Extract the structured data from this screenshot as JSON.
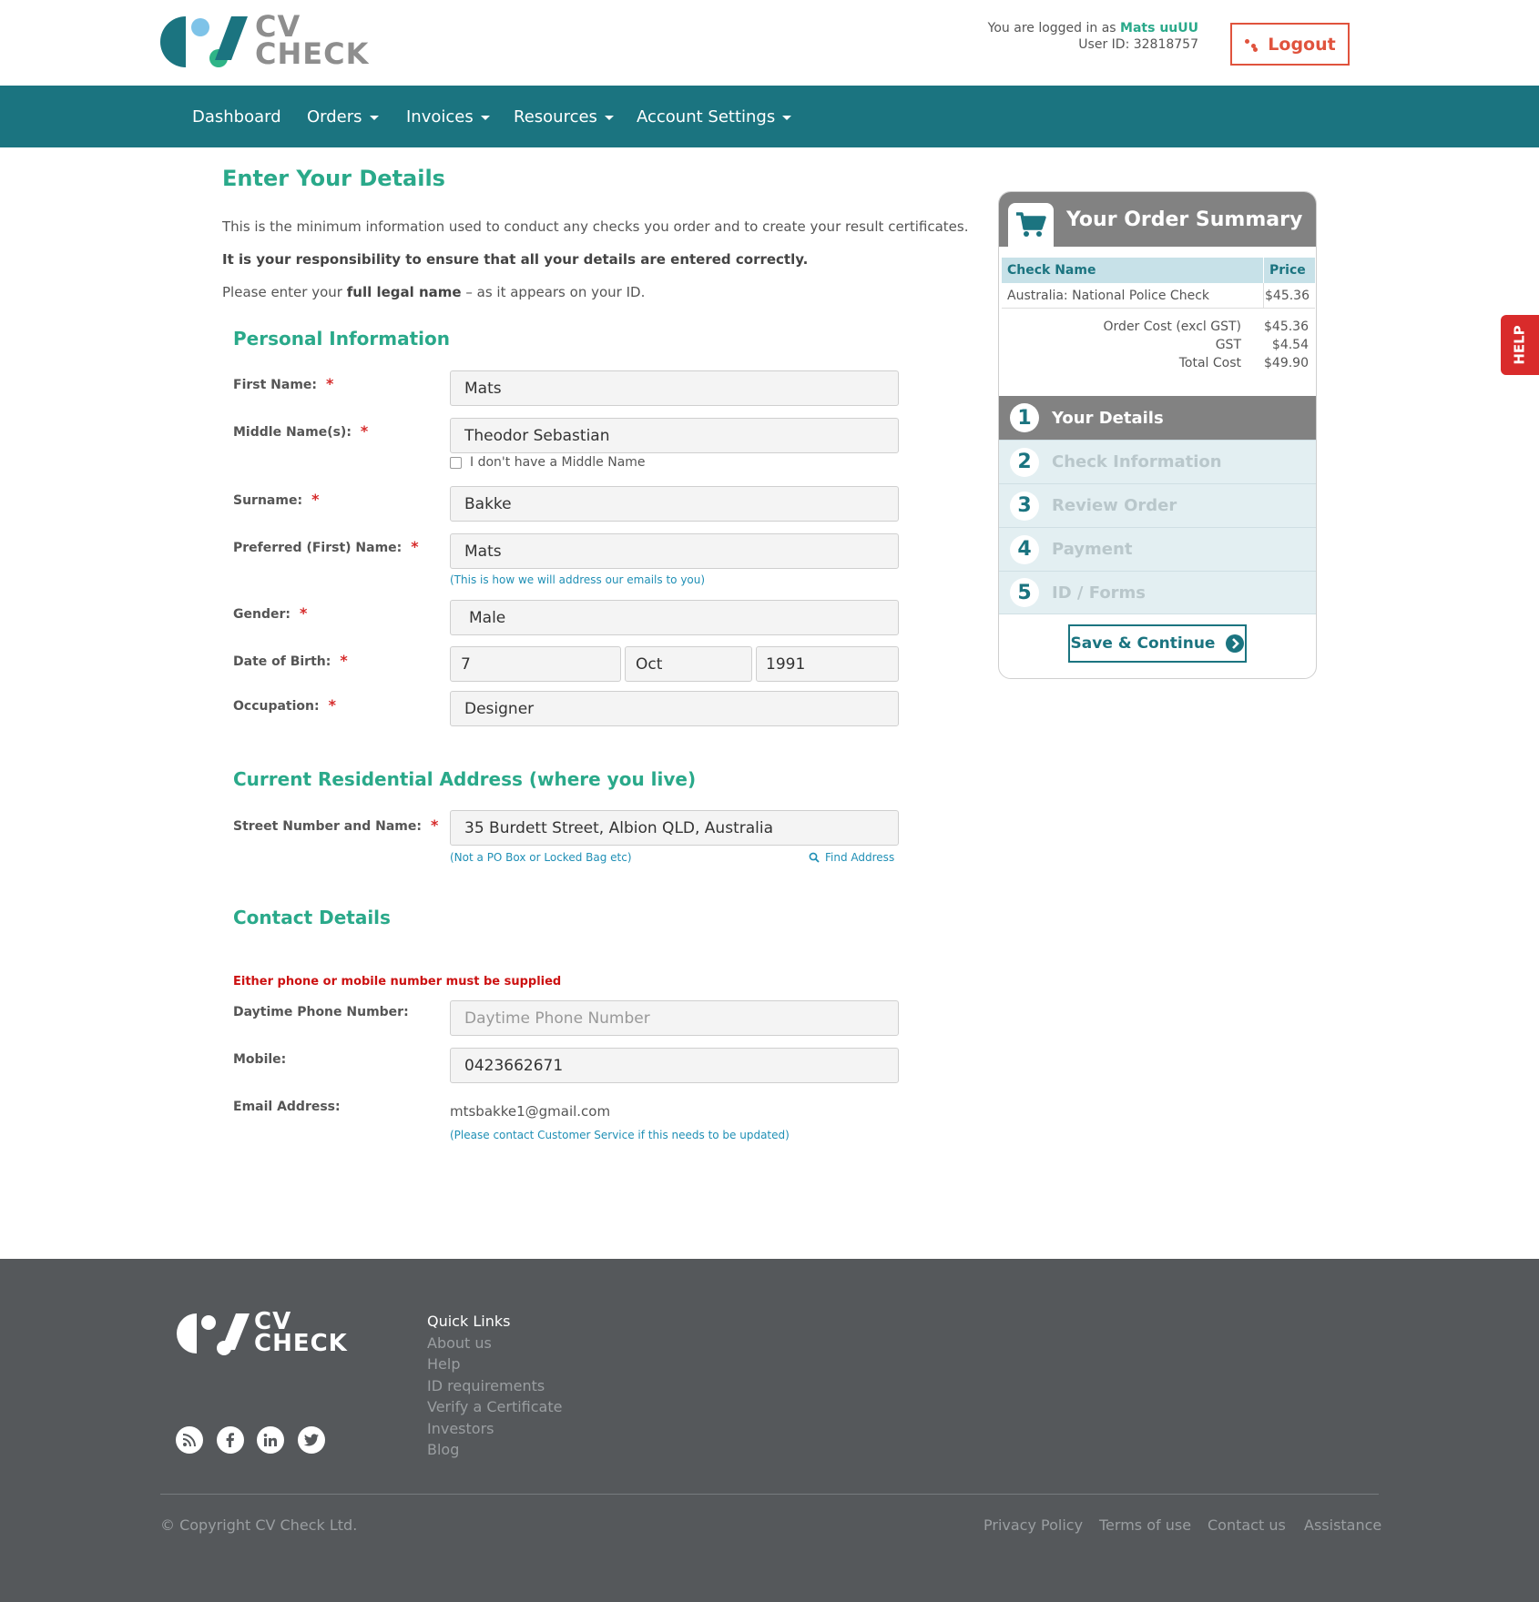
{
  "header": {
    "logo_text_line1": "CV",
    "logo_text_line2": "CHECK",
    "logged_in_prefix": "You are logged in as",
    "user_name": "Mats uuUU",
    "user_id_text": "User ID: 32818757",
    "logout_label": "Logout"
  },
  "nav": {
    "items": [
      {
        "label": "Dashboard"
      },
      {
        "label": "Orders"
      },
      {
        "label": "Invoices"
      },
      {
        "label": "Resources"
      },
      {
        "label": "Account Settings"
      }
    ]
  },
  "main": {
    "title": "Enter Your Details",
    "intro_line1": "This is the minimum information used to conduct any checks you order and to create your result certificates.",
    "intro_line2": "It is your responsibility to ensure that all your details are entered correctly.",
    "intro_line3_pre": "Please enter your",
    "intro_line3_bold": "full legal name",
    "intro_line3_post": "– as it appears on your ID.",
    "personal": {
      "title": "Personal Information",
      "first_name_label": "First Name:",
      "first_name": "Mats",
      "middle_name_label": "Middle Name(s):",
      "middle_name": "Theodor Sebastian",
      "no_middle_label": "I don't have a Middle Name",
      "surname_label": "Surname:",
      "surname": "Bakke",
      "preferred_label": "Preferred (First) Name:",
      "preferred": "Mats",
      "preferred_hint": "(This is how we will address our emails to you)",
      "gender_label": "Gender:",
      "gender": "Male",
      "dob_label": "Date of Birth:",
      "dob_day": "7",
      "dob_month": "Oct",
      "dob_year": "1991",
      "occupation_label": "Occupation:",
      "occupation": "Designer",
      "required_mark": "*"
    },
    "address": {
      "title": "Current Residential Address (where you live)",
      "street_label": "Street Number and Name:",
      "street": "35 Burdett Street, Albion QLD, Australia",
      "street_hint": "(Not a PO Box or Locked Bag etc)",
      "find_address": "Find Address"
    },
    "contact": {
      "title": "Contact Details",
      "error": "Either phone or mobile number must be supplied",
      "daytime_label": "Daytime Phone Number:",
      "daytime_placeholder": "Daytime Phone Number",
      "mobile_label": "Mobile:",
      "mobile": "0423662671",
      "email_label": "Email Address:",
      "email": "mtsbakke1@gmail.com",
      "email_hint": "(Please contact Customer Service if this needs to be updated)"
    }
  },
  "summary": {
    "title": "Your Order Summary",
    "col_check": "Check Name",
    "col_price": "Price",
    "item_name": "Australia: National Police Check",
    "item_price": "$45.36",
    "order_cost_label": "Order Cost (excl GST)",
    "order_cost": "$45.36",
    "gst_label": "GST",
    "gst": "$4.54",
    "total_label": "Total Cost",
    "total": "$49.90",
    "steps": [
      {
        "num": "1",
        "label": "Your Details"
      },
      {
        "num": "2",
        "label": "Check Information"
      },
      {
        "num": "3",
        "label": "Review Order"
      },
      {
        "num": "4",
        "label": "Payment"
      },
      {
        "num": "5",
        "label": "ID / Forms"
      }
    ],
    "save_label": "Save & Continue"
  },
  "help_label": "HELP",
  "footer": {
    "logo_text_line1": "CV",
    "logo_text_line2": "CHECK",
    "quick_links_title": "Quick Links",
    "quick_links": [
      "About us",
      "Help",
      "ID requirements",
      "Verify a Certificate",
      "Investors",
      "Blog"
    ],
    "copyright": "© Copyright CV Check Ltd.",
    "bottom_links": [
      "Privacy Policy",
      "Terms of use",
      "Contact us",
      "Assistance"
    ]
  },
  "colors": {
    "brand_teal": "#1b7480",
    "accent_green": "#2aa98a",
    "logout_red": "#e0533d",
    "footer_bg": "#55585b"
  }
}
